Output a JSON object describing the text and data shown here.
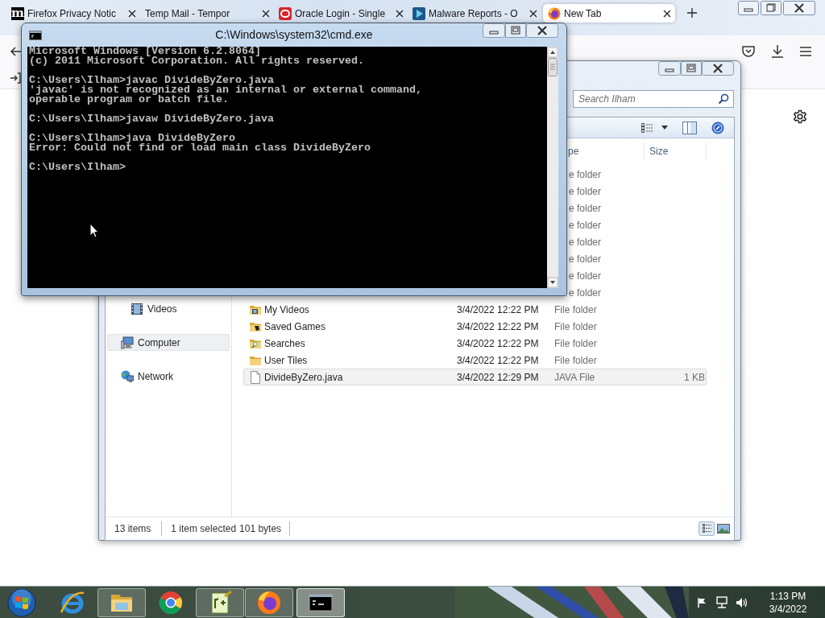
{
  "browser": {
    "tabs": [
      {
        "kind": "letter",
        "icon_text": "m",
        "label": "Firefox Privacy Notic",
        "selected": false
      },
      {
        "kind": "none",
        "label": "Temp Mail - Tempor",
        "selected": false
      },
      {
        "kind": "ring",
        "label": "Oracle Login - Single",
        "selected": false
      },
      {
        "kind": "play",
        "label": "Malware Reports - O",
        "selected": false
      },
      {
        "kind": "fox",
        "label": "New Tab",
        "selected": true
      }
    ]
  },
  "explorer": {
    "search": {
      "placeholder": "Search Ilham"
    },
    "columns": [
      {
        "label": "pe",
        "covered": true
      },
      {
        "label": "Size",
        "covered": false
      }
    ],
    "nav": [
      {
        "kind": "videos",
        "label": "Videos",
        "selected": false
      },
      {
        "kind": "computer",
        "label": "Computer",
        "selected": true
      },
      {
        "kind": "network",
        "label": "Network",
        "selected": false
      }
    ],
    "rows": [
      {
        "covered": true,
        "type": "e folder",
        "selected": false
      },
      {
        "covered": true,
        "type": "e folder",
        "selected": false
      },
      {
        "covered": true,
        "type": "e folder",
        "selected": false
      },
      {
        "covered": true,
        "type": "e folder",
        "selected": false
      },
      {
        "covered": true,
        "type": "e folder",
        "selected": false
      },
      {
        "covered": true,
        "type": "e folder",
        "selected": false
      },
      {
        "covered": true,
        "type": "e folder",
        "selected": false
      },
      {
        "covered": true,
        "type": "e folder",
        "selected": false
      },
      {
        "covered": false,
        "kind": "videos",
        "name": "My Videos",
        "date": "3/4/2022 12:22 PM",
        "type": "File folder",
        "selected": false
      },
      {
        "covered": false,
        "kind": "games",
        "name": "Saved Games",
        "date": "3/4/2022 12:22 PM",
        "type": "File folder",
        "selected": false
      },
      {
        "covered": false,
        "kind": "search",
        "name": "Searches",
        "date": "3/4/2022 12:22 PM",
        "type": "File folder",
        "selected": false
      },
      {
        "covered": false,
        "kind": "folder",
        "name": "User Tiles",
        "date": "3/4/2022 12:22 PM",
        "type": "File folder",
        "selected": false
      },
      {
        "covered": false,
        "kind": "file",
        "name": "DivideByZero.java",
        "date": "3/4/2022 12:29 PM",
        "type": "JAVA File",
        "size": "1 KB",
        "selected": true
      }
    ],
    "status": {
      "count": "13 items",
      "selection": "1 item selected",
      "size": "101 bytes"
    },
    "views": [
      {
        "kind": "details",
        "selected": true
      },
      {
        "kind": "preview",
        "selected": false
      }
    ]
  },
  "cmd": {
    "title": "C:\\Windows\\system32\\cmd.exe",
    "blocks": [
      [
        "Microsoft Windows [Version 6.2.8064]",
        "(c) 2011 Microsoft Corporation. All rights reserved."
      ],
      [
        "C:\\Users\\Ilham>javac DivideByZero.java",
        "'javac' is not recognized as an internal or external command,",
        "operable program or batch file."
      ],
      [
        "C:\\Users\\Ilham>javaw DivideByZero.java"
      ],
      [
        "C:\\Users\\Ilham>java DivideByZero",
        "Error: Could not find or load main class DivideByZero"
      ],
      [
        "C:\\Users\\Ilham>"
      ]
    ]
  },
  "taskbar": {
    "items": [
      {
        "kind": "start"
      },
      {
        "kind": "ie",
        "running": false,
        "selected": false
      },
      {
        "kind": "explorer",
        "running": true,
        "selected": false
      },
      {
        "kind": "chrome",
        "running": false,
        "selected": false
      },
      {
        "kind": "notepad",
        "running": true,
        "selected": false
      },
      {
        "kind": "firefox",
        "running": true,
        "selected": false
      },
      {
        "kind": "cmd",
        "running": true,
        "selected": true
      }
    ],
    "clock": {
      "time": "1:13 PM",
      "date": "3/4/2022"
    }
  }
}
